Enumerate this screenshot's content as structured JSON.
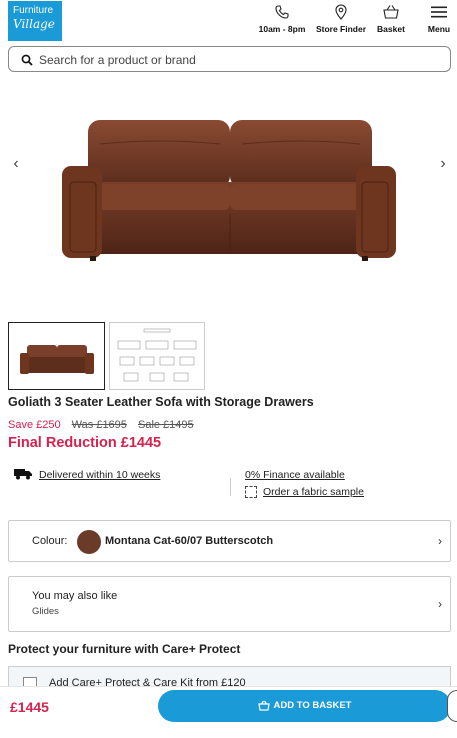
{
  "header": {
    "logo": {
      "line1": "Furniture",
      "line2": "Village"
    },
    "nav": [
      {
        "id": "hours",
        "label": "10am - 8pm",
        "icon": "phone-icon"
      },
      {
        "id": "store",
        "label": "Store Finder",
        "icon": "map-pin-icon"
      },
      {
        "id": "basket",
        "label": "Basket",
        "icon": "basket-icon"
      },
      {
        "id": "menu",
        "label": "Menu",
        "icon": "hamburger-icon"
      }
    ]
  },
  "search": {
    "placeholder": "Search for a product or brand"
  },
  "product": {
    "title": "Goliath 3 Seater Leather Sofa with Storage Drawers",
    "save": "Save £250",
    "was": "Was £1695",
    "sale": "Sale £1495",
    "final": "Final Reduction £1445"
  },
  "info": {
    "delivery": "Delivered within 10 weeks",
    "finance": "0% Finance available",
    "sample": "Order a fabric sample"
  },
  "colour": {
    "label": "Colour:",
    "value": "Montana Cat-60/07 Butterscotch",
    "swatch": "#6b3b2a"
  },
  "also": {
    "title": "You may also like",
    "item": "Glides"
  },
  "protect": {
    "heading": "Protect your furniture with Care+ Protect",
    "option": "Add Care+ Protect & Care Kit from £120"
  },
  "footer": {
    "price": "£1445",
    "button": "ADD TO BASKET"
  },
  "colors": {
    "brand": "#1a9ad6",
    "sale": "#d6224e"
  }
}
